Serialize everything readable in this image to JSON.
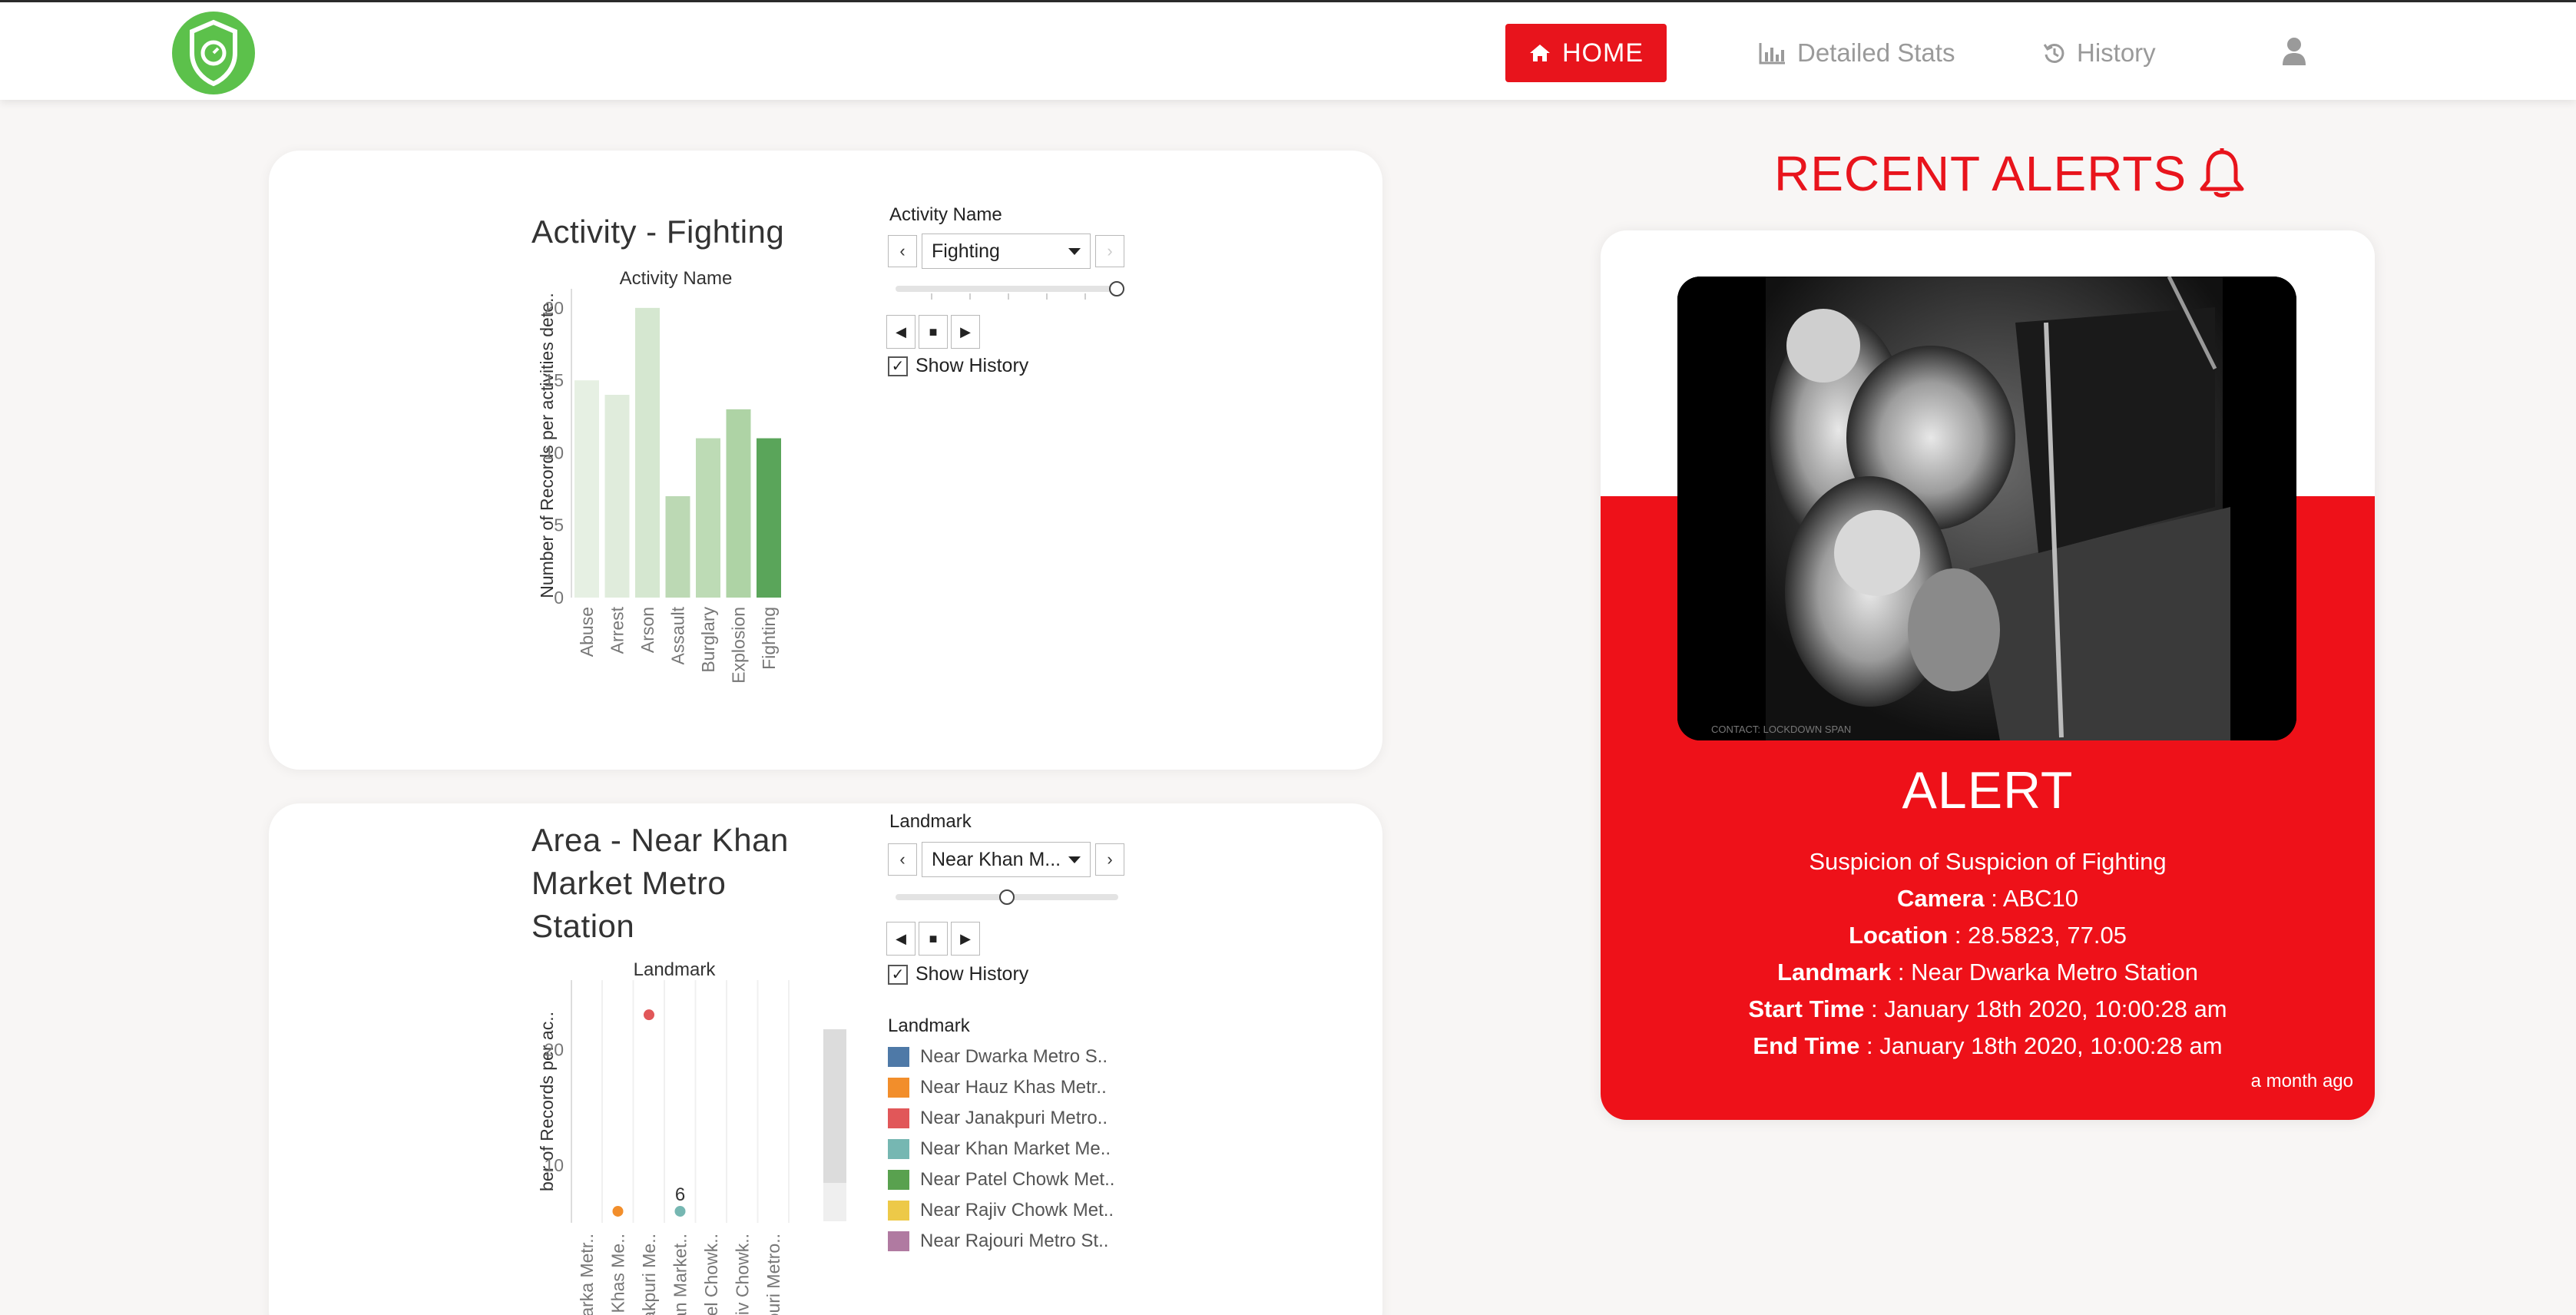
{
  "nav": {
    "home_label": "HOME",
    "stats_label": "Detailed Stats",
    "history_label": "History",
    "brand_color": "#e8141c",
    "logo_color": "#5cc14b"
  },
  "activity_panel": {
    "title": "Activity - Fighting",
    "control_label": "Activity Name",
    "selected": "Fighting",
    "show_history_label": "Show History",
    "show_history_checked": true,
    "slider_position": 1.0
  },
  "area_panel": {
    "title_line1": "Area - Near Khan",
    "title_line2": "Market Metro",
    "title_line3": "Station",
    "control_label": "Landmark",
    "selected": "Near Khan M...",
    "show_history_label": "Show History",
    "show_history_checked": true,
    "slider_position": 0.5,
    "legend_title": "Landmark",
    "legend": [
      {
        "label": "Near Dwarka Metro S..",
        "color": "#4e79a7"
      },
      {
        "label": "Near Hauz Khas Metr..",
        "color": "#f28e2b"
      },
      {
        "label": "Near Janakpuri Metro..",
        "color": "#e15759"
      },
      {
        "label": "Near Khan Market Me..",
        "color": "#76b7b2"
      },
      {
        "label": "Near Patel Chowk Met..",
        "color": "#59a14f"
      },
      {
        "label": "Near Rajiv Chowk Met..",
        "color": "#edc948"
      },
      {
        "label": "Near Rajouri Metro St..",
        "color": "#b07aa1"
      }
    ]
  },
  "chart_data": [
    {
      "type": "bar",
      "title": "Activity Name",
      "ylabel": "Number of Records per activities dete..",
      "categories": [
        "Abuse",
        "Arrest",
        "Arson",
        "Assault",
        "Burglary",
        "Explosion",
        "Fighting"
      ],
      "values": [
        15,
        14,
        20,
        7,
        11,
        13,
        11
      ],
      "ylim": [
        0,
        21
      ],
      "yticks": [
        0,
        5,
        10,
        15,
        20
      ],
      "highlight": "Fighting",
      "colors": [
        "#e6f0e3",
        "#e0ecdc",
        "#d5e7d0",
        "#bcd9b4",
        "#bddbb5",
        "#aed3a5",
        "#5aa55a"
      ]
    },
    {
      "type": "scatter",
      "title": "Landmark",
      "ylabel": "ber of Records per ac..",
      "categories": [
        "Near Dwarka Metr..",
        "Near Hauz Khas Me..",
        "Near Janakpuri Me..",
        "Near Khan Market..",
        "Near Patel Chowk..",
        "Near Rajiv Chowk..",
        "Near Rajouri Metro.."
      ],
      "category_labels": [
        "Dwarka Metr..",
        "Hauz Khas Me..",
        "Janakpuri Me..",
        "Khan Market..",
        "Patel Chowk..",
        "Rajiv Chowk..",
        "Rajouri Metro.."
      ],
      "points": [
        {
          "category": "Near Hauz Khas Me..",
          "y": 6,
          "color": "#f28e2b"
        },
        {
          "category": "Near Janakpuri Me..",
          "y": 23,
          "color": "#e15759"
        },
        {
          "category": "Near Khan Market..",
          "y": 6,
          "color": "#76b7b2",
          "label": "6"
        }
      ],
      "ylim": [
        5,
        26
      ],
      "yticks": [
        10,
        20
      ]
    }
  ],
  "alerts": {
    "heading": "RECENT ALERTS",
    "title": "ALERT",
    "description": "Suspicion of Suspicion of Fighting",
    "camera_label": "Camera",
    "camera_value": " : ABC10",
    "location_label": "Location",
    "location_value": " : 28.5823, 77.05",
    "landmark_label": "Landmark",
    "landmark_value": " : Near Dwarka Metro Station",
    "start_label": "Start Time",
    "start_value": " : January 18th 2020, 10:00:28 am",
    "end_label": "End Time",
    "end_value": " : January 18th 2020, 10:00:28 am",
    "ago": "a month ago",
    "image_caption": "CONTACT: LOCKDOWN SPAN"
  }
}
